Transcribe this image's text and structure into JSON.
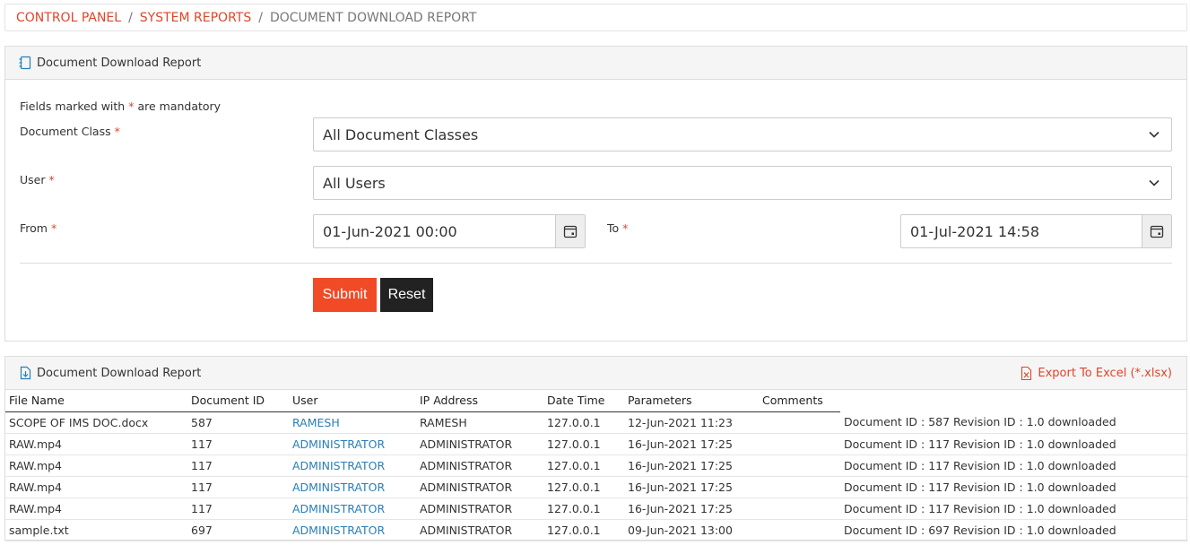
{
  "breadcrumb": {
    "items": [
      "CONTROL PANEL",
      "SYSTEM REPORTS"
    ],
    "sep": "/",
    "current": "DOCUMENT DOWNLOAD REPORT"
  },
  "filter_panel": {
    "title": "Document Download Report",
    "note_prefix": "Fields marked with",
    "note_star": "*",
    "note_suffix": "are mandatory",
    "doc_class_label": "Document Class",
    "doc_class_value": "All Document Classes",
    "user_label": "User",
    "user_value": "All Users",
    "from_label": "From",
    "from_value": "01-Jun-2021 00:00",
    "to_label": "To",
    "to_value": "01-Jul-2021 14:58",
    "star": "*",
    "submit_label": "Submit",
    "reset_label": "Reset"
  },
  "result_panel": {
    "title": "Document Download Report",
    "export_label": "Export To Excel (*.xlsx)",
    "columns": [
      "File Name",
      "Document ID",
      "User",
      "IP Address",
      "Date Time",
      "Parameters",
      "Comments"
    ],
    "rows": [
      {
        "file": "SCOPE OF IMS DOC.docx",
        "doc_id": "587",
        "user": "RAMESH",
        "ip_user": "RAMESH",
        "ip": "127.0.0.1",
        "datetime": "12-Jun-2021 11:23",
        "comment": "Document ID : 587 Revision ID : 1.0 downloaded"
      },
      {
        "file": "RAW.mp4",
        "doc_id": "117",
        "user": "ADMINISTRATOR",
        "ip_user": "ADMINISTRATOR",
        "ip": "127.0.0.1",
        "datetime": "16-Jun-2021 17:25",
        "comment": "Document ID : 117 Revision ID : 1.0 downloaded"
      },
      {
        "file": "RAW.mp4",
        "doc_id": "117",
        "user": "ADMINISTRATOR",
        "ip_user": "ADMINISTRATOR",
        "ip": "127.0.0.1",
        "datetime": "16-Jun-2021 17:25",
        "comment": "Document ID : 117 Revision ID : 1.0 downloaded"
      },
      {
        "file": "RAW.mp4",
        "doc_id": "117",
        "user": "ADMINISTRATOR",
        "ip_user": "ADMINISTRATOR",
        "ip": "127.0.0.1",
        "datetime": "16-Jun-2021 17:25",
        "comment": "Document ID : 117 Revision ID : 1.0 downloaded"
      },
      {
        "file": "RAW.mp4",
        "doc_id": "117",
        "user": "ADMINISTRATOR",
        "ip_user": "ADMINISTRATOR",
        "ip": "127.0.0.1",
        "datetime": "16-Jun-2021 17:25",
        "comment": "Document ID : 117 Revision ID : 1.0 downloaded"
      },
      {
        "file": "sample.txt",
        "doc_id": "697",
        "user": "ADMINISTRATOR",
        "ip_user": "ADMINISTRATOR",
        "ip": "127.0.0.1",
        "datetime": "09-Jun-2021 13:00",
        "comment": "Document ID : 697 Revision ID : 1.0 downloaded"
      }
    ]
  },
  "colors": {
    "accent": "#f04a26",
    "link": "#2a7fb8",
    "dark_button": "#222222"
  },
  "icons": {
    "filter_panel": "notebook-icon",
    "result_panel": "document-download-icon",
    "export": "excel-file-icon",
    "select": "chevron-down-icon",
    "date": "calendar-icon"
  }
}
